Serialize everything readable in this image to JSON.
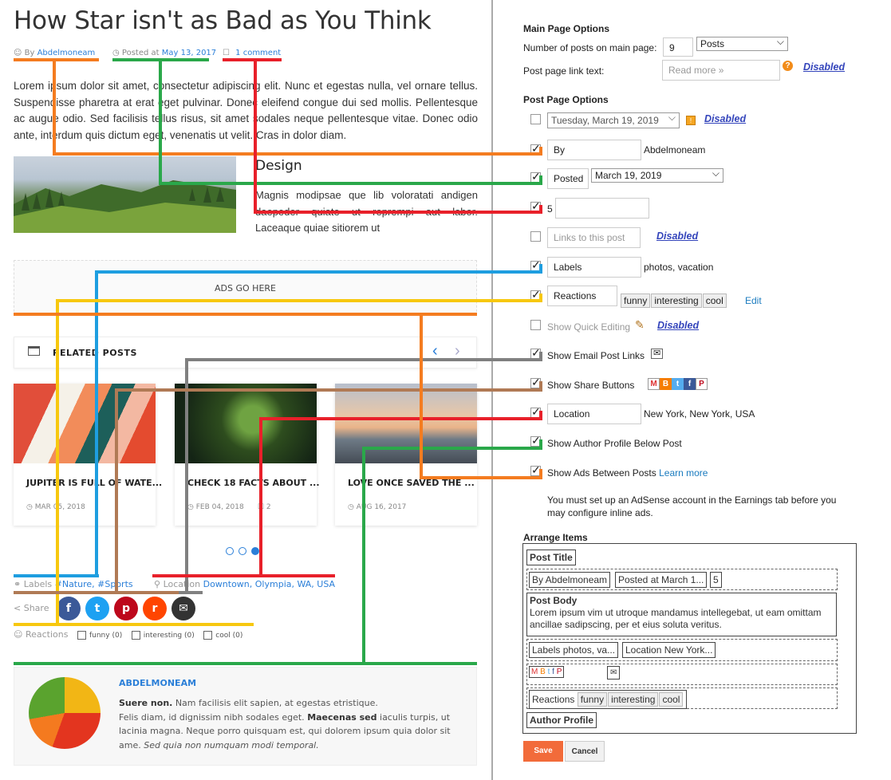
{
  "post": {
    "title": "How Star isn't as Bad as You Think",
    "by_prefix": "By",
    "author": "Abdelmoneam",
    "posted_prefix": "Posted at",
    "date": "May 13, 2017",
    "comments": "1 comment",
    "body": "Lorem ipsum dolor sit amet, consectetur adipiscing elit. Nunc et egestas nulla, vel ornare tellus. Suspendisse pharetra at erat eget pulvinar. Donec eleifend congue dui sed mollis. Pellentesque ac augue odio. Sed facilisis tellus risus, sit amet sodales neque pellentesque vitae. Donec odio ante, interdum quis dictum eget, venenatis ut velit. Cras in dolor diam.",
    "subheading": "Design",
    "subtext": "Magnis modipsae que lib voloratati andigen daepeder quiate ut reprempi aut labor. Laceaque quiae sitiorem ut"
  },
  "ads": {
    "label": "ADS GO HERE"
  },
  "related": {
    "label": "RELATED POSTS",
    "cards": [
      {
        "title": "JUPITER IS FULL OF WATE...",
        "date": "MAR 05, 2018",
        "comments": ""
      },
      {
        "title": "CHECK 18 FACTS ABOUT ...",
        "date": "FEB 04, 2018",
        "comments": "2"
      },
      {
        "title": "LOVE ONCE SAVED THE ...",
        "date": "AUG 16, 2017",
        "comments": ""
      }
    ]
  },
  "footer": {
    "labels_prefix": "Labels",
    "label1": "#Nature,",
    "label2": "#Sports",
    "location_prefix": "Location",
    "location": "Downtown, Olympia, WA, USA",
    "share": "Share",
    "reactions": "Reactions",
    "r1": "funny (0)",
    "r2": "interesting (0)",
    "r3": "cool (0)"
  },
  "author_box": {
    "name": "ABDELMONEAM",
    "bio_bold": "Suere non.",
    "bio1": " Nam facilisis elit sapien, at egestas etristique.",
    "bio2": "Felis diam, id dignissim nibh sodales eget. ",
    "bio_bold2": "Maecenas sed",
    "bio3": " iaculis turpis, ut lacinia magna. Neque porro quisquam est, qui dolorem ipsum quia dolor sit ame. ",
    "bio_it": "Sed quia non numquam modi temporal."
  },
  "settings": {
    "main_heading": "Main Page Options",
    "num_posts_label": "Number of posts on main page:",
    "num_posts": "9",
    "posts_unit": "Posts",
    "post_link_label": "Post page link text:",
    "post_link_ph": "Read more »",
    "disabled": "Disabled",
    "post_heading": "Post Page Options",
    "date_value": "Tuesday, March 19, 2019",
    "by_box": "By",
    "by_value": "Abdelmoneam",
    "posted_box": "Posted",
    "posted_value": "March 19, 2019",
    "comments_num": "5",
    "links_ph": "Links to this post",
    "labels_box": "Labels",
    "labels_value": "photos, vacation",
    "reactions_box": "Reactions",
    "react_tags": [
      "funny",
      "interesting",
      "cool"
    ],
    "edit": "Edit",
    "quick_edit": "Show Quick Editing",
    "email_links": "Show Email Post Links",
    "share_buttons": "Show Share Buttons",
    "location_box": "Location",
    "location_value": "New York, New York, USA",
    "author_profile": "Show Author Profile Below Post",
    "ads_between": "Show Ads Between Posts",
    "learn_more": "Learn more",
    "adsense_note": "You must set up an AdSense account in the Earnings tab before you may configure inline ads.",
    "arrange_heading": "Arrange Items",
    "a_title": "Post Title",
    "a_by": "By Abdelmoneam",
    "a_posted": "Posted at March 1...",
    "a_five": "5",
    "a_body": "Post Body",
    "a_body_text": "Lorem ipsum vim ut utroque mandamus intellegebat, ut eam omittam ancillae sadipscing, per et eius soluta veritus.",
    "a_labels": "Labels photos, va...",
    "a_location": "Location New York...",
    "a_reactions": "Reactions",
    "a_profile": "Author Profile",
    "save": "Save",
    "cancel": "Cancel"
  },
  "colors": {
    "orange": "#f47c20",
    "green": "#2aa84a",
    "red": "#e8202a",
    "blue": "#1e9ee0",
    "yellow": "#f7c80f",
    "brown": "#b07a55",
    "gray": "#808080",
    "accent_link": "#2b7fd8",
    "save_bg": "#f26b3a"
  }
}
